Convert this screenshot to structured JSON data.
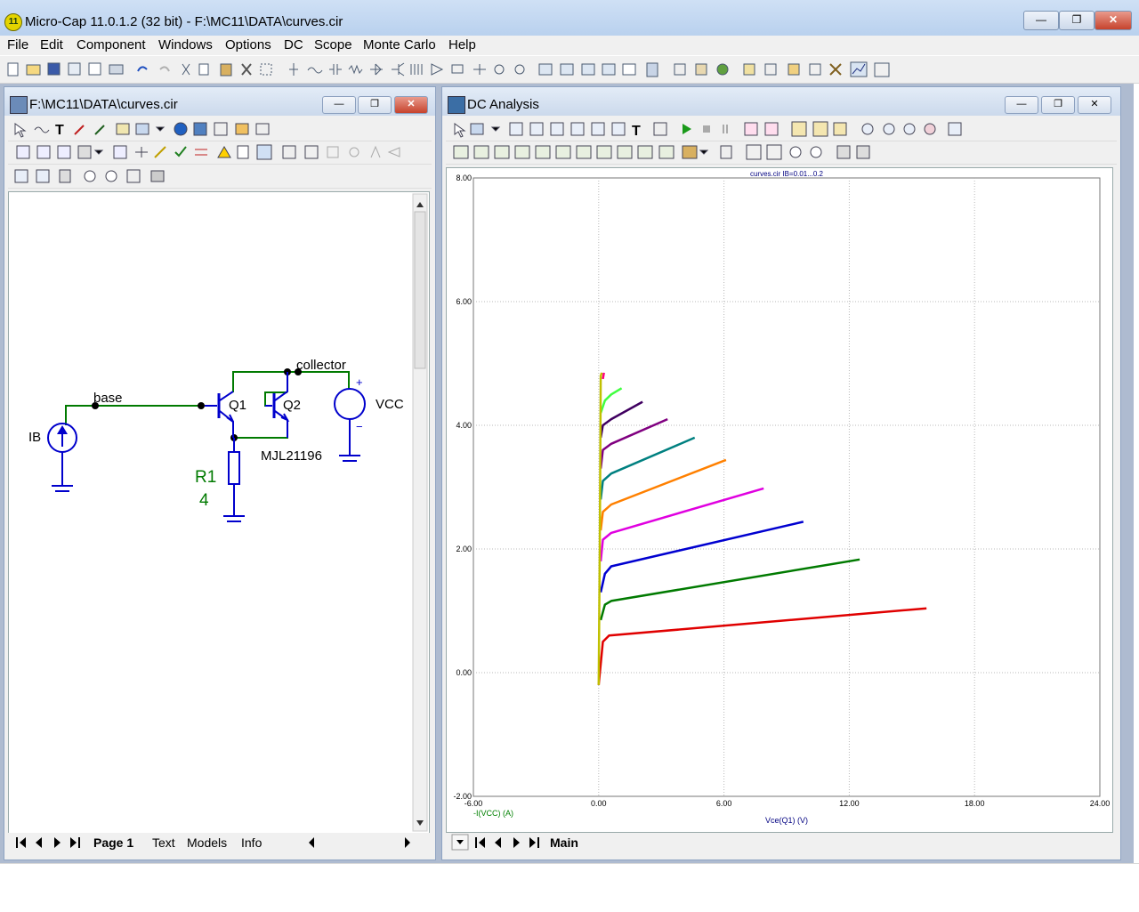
{
  "window": {
    "app_title": "Micro-Cap 11.0.1.2 (32 bit) - F:\\MC11\\DATA\\curves.cir",
    "app_icon_text": "11",
    "minimize": "—",
    "maximize": "❐",
    "close": "✕"
  },
  "menu": [
    "File",
    "Edit",
    "Component",
    "Windows",
    "Options",
    "DC",
    "Scope",
    "Monte Carlo",
    "Help"
  ],
  "schematic": {
    "title": "F:\\MC11\\DATA\\curves.cir",
    "labels": {
      "base": "base",
      "collector": "collector",
      "q1": "Q1",
      "q2": "Q2",
      "vcc": "VCC",
      "ib": "IB",
      "r1": "R1",
      "r1_value": "4",
      "model": "MJL21196",
      "plus": "+",
      "minus": "−"
    },
    "tabs": [
      "Page 1",
      "Text",
      "Models",
      "Info"
    ],
    "active_tab": "Page 1"
  },
  "analysis": {
    "title": "DC Analysis",
    "tabs": [
      "Main"
    ],
    "active_tab": "Main"
  },
  "chart_data": {
    "type": "line",
    "title": "curves.cir IB=0.01...0.2",
    "xlabel": "Vce(Q1) (V)",
    "ylabel": "-I(VCC) (A)",
    "xlim": [
      -6,
      24
    ],
    "ylim": [
      -2,
      8
    ],
    "x_ticks": [
      "-6.00",
      "0.00",
      "6.00",
      "12.00",
      "18.00",
      "24.00"
    ],
    "y_ticks": [
      "-2.00",
      "0.00",
      "2.00",
      "4.00",
      "6.00",
      "8.00"
    ],
    "grid": true,
    "series": [
      {
        "color": "#e00000",
        "points": [
          [
            0,
            -0.2
          ],
          [
            0.2,
            0.5
          ],
          [
            0.5,
            0.6
          ],
          [
            15.7,
            1.04
          ]
        ]
      },
      {
        "color": "#007a00",
        "points": [
          [
            0.1,
            0.85
          ],
          [
            0.3,
            1.1
          ],
          [
            0.6,
            1.16
          ],
          [
            12.5,
            1.83
          ]
        ]
      },
      {
        "color": "#0000d0",
        "points": [
          [
            0.1,
            1.3
          ],
          [
            0.3,
            1.6
          ],
          [
            0.6,
            1.72
          ],
          [
            9.8,
            2.44
          ]
        ]
      },
      {
        "color": "#e000e0",
        "points": [
          [
            0.1,
            1.8
          ],
          [
            0.2,
            2.15
          ],
          [
            0.6,
            2.26
          ],
          [
            7.9,
            2.98
          ]
        ]
      },
      {
        "color": "#ff8000",
        "points": [
          [
            0.1,
            2.3
          ],
          [
            0.2,
            2.6
          ],
          [
            0.6,
            2.72
          ],
          [
            6.1,
            3.44
          ]
        ]
      },
      {
        "color": "#008080",
        "points": [
          [
            0.1,
            2.8
          ],
          [
            0.2,
            3.1
          ],
          [
            0.6,
            3.22
          ],
          [
            4.6,
            3.8
          ]
        ]
      },
      {
        "color": "#800080",
        "points": [
          [
            0.1,
            3.3
          ],
          [
            0.2,
            3.6
          ],
          [
            0.6,
            3.7
          ],
          [
            3.3,
            4.1
          ]
        ]
      },
      {
        "color": "#400060",
        "points": [
          [
            0.1,
            3.8
          ],
          [
            0.2,
            4.0
          ],
          [
            0.6,
            4.1
          ],
          [
            2.1,
            4.38
          ]
        ]
      },
      {
        "color": "#40ff40",
        "points": [
          [
            0.1,
            4.2
          ],
          [
            0.3,
            4.4
          ],
          [
            0.6,
            4.5
          ],
          [
            1.1,
            4.6
          ]
        ]
      },
      {
        "color": "#c0c000",
        "points": [
          [
            0,
            -0.2
          ],
          [
            0.05,
            2
          ],
          [
            0.1,
            4.8
          ],
          [
            0.15,
            4.85
          ]
        ]
      },
      {
        "color": "#ff0080",
        "points": [
          [
            0.2,
            4.75
          ],
          [
            0.25,
            4.85
          ]
        ]
      }
    ]
  }
}
